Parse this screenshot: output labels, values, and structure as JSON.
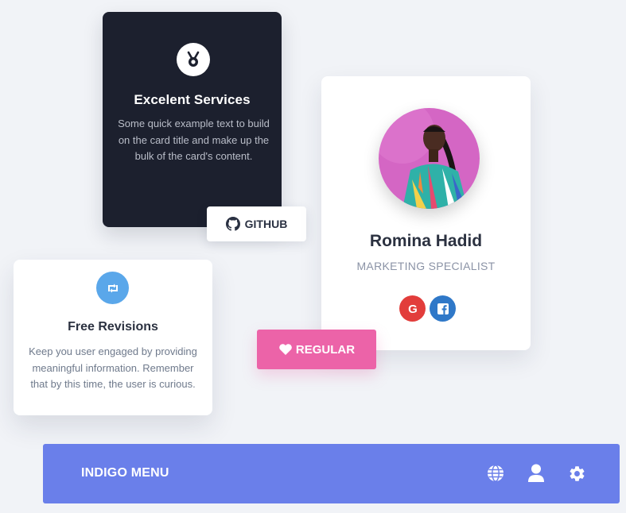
{
  "services_card": {
    "icon": "medal-icon",
    "title": "Excelent Services",
    "body": "Some quick example text to build on the card title and make up the bulk of the card's content."
  },
  "github_button": {
    "icon": "github-icon",
    "label": "GITHUB"
  },
  "profile_card": {
    "name": "Romina Hadid",
    "role": "MARKETING SPECIALIST",
    "avatar": "avatar-photo",
    "social": [
      "google-icon",
      "facebook-icon"
    ]
  },
  "regular_button": {
    "icon": "heart-icon",
    "label": "REGULAR",
    "color": "#ec63a8"
  },
  "revisions_card": {
    "icon": "retweet-icon",
    "title": "Free Revisions",
    "body": "Keep you user engaged by providing meaningful information. Remember that by this time, the user is curious."
  },
  "menu": {
    "title": "INDIGO MENU",
    "color": "#6a7fea",
    "icons": [
      "globe-icon",
      "user-icon",
      "gear-icon"
    ]
  }
}
